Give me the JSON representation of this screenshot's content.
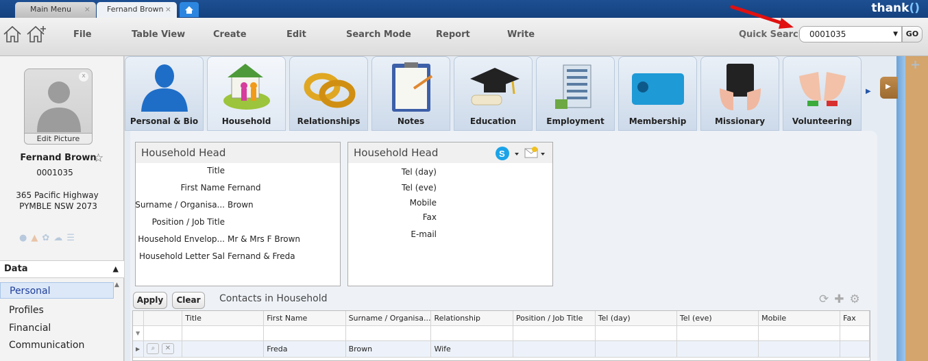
{
  "window": {
    "tabs": [
      {
        "label": "Main Menu"
      },
      {
        "label": "Fernand Brown"
      }
    ],
    "tab_close": "×",
    "brand": "thank"
  },
  "toolbar": {
    "menus": [
      "File",
      "Table View",
      "Create",
      "Edit",
      "Search Mode",
      "Report",
      "Write"
    ],
    "quick_search_label": "Quick Search",
    "quick_search_value": "0001035",
    "go_label": "GO"
  },
  "profile": {
    "edit_picture": "Edit Picture",
    "name": "Fernand Brown",
    "id": "0001035",
    "address_line1": "365 Pacific Highway",
    "address_line2": "PYMBLE NSW 2073",
    "close_glyph": "x"
  },
  "sidebar": {
    "section": "Data",
    "items": [
      "Personal",
      "Profiles",
      "Financial",
      "Communication"
    ]
  },
  "module_tabs": [
    {
      "label": "Personal & Bio",
      "icon": "person-icon"
    },
    {
      "label": "Household",
      "icon": "house-family-icon"
    },
    {
      "label": "Relationships",
      "icon": "rings-icon"
    },
    {
      "label": "Notes",
      "icon": "clipboard-icon"
    },
    {
      "label": "Education",
      "icon": "graduation-cap-icon"
    },
    {
      "label": "Employment",
      "icon": "building-icon"
    },
    {
      "label": "Membership",
      "icon": "membership-card-icon"
    },
    {
      "label": "Missionary",
      "icon": "bible-hands-icon"
    },
    {
      "label": "Volunteering",
      "icon": "raised-hands-icon"
    }
  ],
  "household_panel": {
    "title": "Household Head",
    "fields": [
      {
        "label": "Title",
        "value": ""
      },
      {
        "label": "First Name",
        "value": "Fernand"
      },
      {
        "label": "Surname / Organisa...",
        "value": "Brown"
      },
      {
        "label": "Position / Job Title",
        "value": ""
      },
      {
        "label": "Household Envelop...",
        "value": "Mr & Mrs F Brown"
      },
      {
        "label": "Household Letter Sal",
        "value": "Fernand & Freda"
      }
    ]
  },
  "contact_panel": {
    "title": "Household Head",
    "fields": [
      {
        "label": "Tel (day)",
        "value": ""
      },
      {
        "label": "Tel (eve)",
        "value": ""
      },
      {
        "label": "Mobile",
        "value": ""
      },
      {
        "label": "Fax",
        "value": ""
      },
      {
        "label": "E-mail",
        "value": ""
      }
    ]
  },
  "contacts_grid": {
    "apply_label": "Apply",
    "clear_label": "Clear",
    "title": "Contacts in Household",
    "columns": [
      "Title",
      "First Name",
      "Surname / Organisa...",
      "Relationship",
      "Position / Job Title",
      "Tel (day)",
      "Tel (eve)",
      "Mobile",
      "Fax"
    ],
    "rows": [
      [
        "",
        "Freda",
        "Brown",
        "Wife",
        "",
        "",
        "",
        "",
        ""
      ]
    ]
  },
  "colors": {
    "title_bar": "#1d4f92",
    "selected_item": "#dce8f8",
    "annotation_arrow": "#e01010"
  }
}
